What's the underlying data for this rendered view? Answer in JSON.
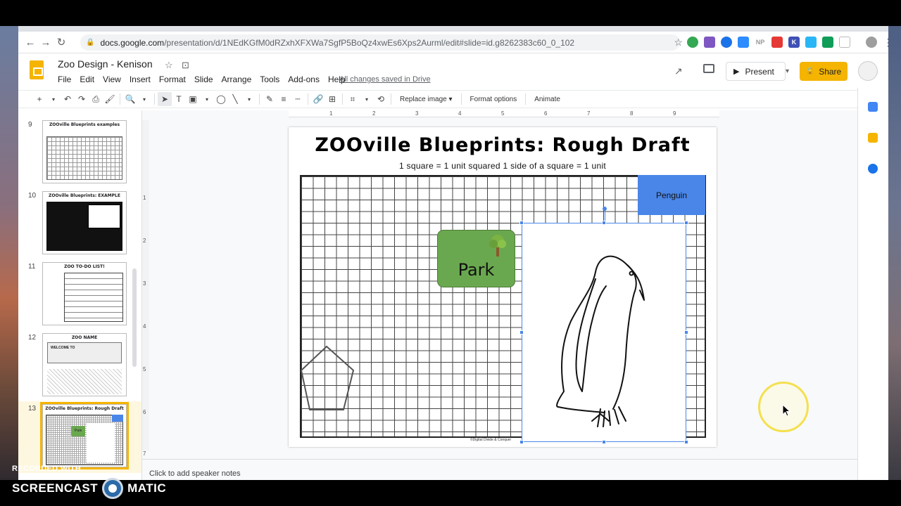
{
  "browser": {
    "url_host": "docs.google.com",
    "url_path": "/presentation/d/1NEdKGfM0dRZxhXFXWa7SgfP5BoQz4xwEs6Xps2Aurml/edit#slide=id.g8262383c60_0_102"
  },
  "docs": {
    "title": "Zoo Design - Kenison",
    "menu": [
      "File",
      "Edit",
      "View",
      "Insert",
      "Format",
      "Slide",
      "Arrange",
      "Tools",
      "Add-ons",
      "Help"
    ],
    "saved_status": "All changes saved in Drive",
    "present_label": "Present",
    "share_label": "Share"
  },
  "toolbar": {
    "replace_image": "Replace image",
    "format_options": "Format options",
    "animate": "Animate"
  },
  "ruler": {
    "top_ticks": [
      "1",
      "2",
      "3",
      "4",
      "5",
      "6",
      "7",
      "8",
      "9"
    ],
    "left_ticks": [
      "1",
      "2",
      "3",
      "4",
      "5",
      "6",
      "7"
    ]
  },
  "filmstrip": {
    "slides": [
      {
        "number": "9",
        "title": "ZOOville Blueprints examples"
      },
      {
        "number": "10",
        "title": "ZOOville Blueprints: EXAMPLE"
      },
      {
        "number": "11",
        "title": "ZOO TO-DO LIST!"
      },
      {
        "number": "12",
        "title": "ZOO NAME",
        "subtitle": "WELCOME TO"
      },
      {
        "number": "13",
        "title": "ZOOville Blueprints: Rough Draft",
        "mini_label": "Park"
      }
    ]
  },
  "slide": {
    "title": "ZOOville Blueprints:   Rough Draft",
    "subtitle": "1 square = 1 unit squared     1 side of a square = 1 unit",
    "penguin_label": "Penguin",
    "park_label": "Park",
    "copyright": "©Digital Divide & Conquer"
  },
  "notes": {
    "placeholder": "Click to add speaker notes"
  },
  "watermark": {
    "recorded_with": "RECORDED WITH",
    "brand_left": "SCREENCAST",
    "brand_right": "MATIC"
  },
  "colors": {
    "accent_yellow": "#f4b400",
    "penguin_blue": "#4a86e8",
    "park_green": "#6aa84f",
    "selection_blue": "#4a86e8"
  }
}
